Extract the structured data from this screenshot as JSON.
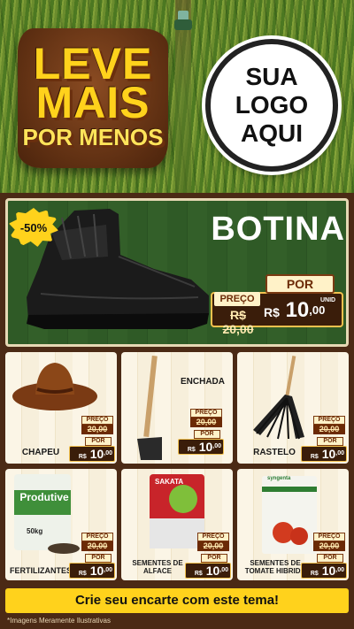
{
  "promo": {
    "line1": "LEVE",
    "line2": "MAIS",
    "line3": "POR MENOS"
  },
  "logo": {
    "text": "SUA LOGO AQUI"
  },
  "featured": {
    "discount": "-50%",
    "title": "BOTINA",
    "preco_label": "PREÇO",
    "por_label": "POR",
    "old_price": "R$ 20,00",
    "currency": "R$",
    "new_price_int": "10",
    "new_price_cents": ",00",
    "unit": "UNID"
  },
  "products": [
    {
      "name": "CHAPEU",
      "preco_label": "PREÇO",
      "old_price": "20,00",
      "por_label": "POR",
      "currency": "R$",
      "new_int": "10",
      "new_cents": ",00"
    },
    {
      "name": "ENCHADA",
      "preco_label": "PREÇO",
      "old_price": "20,00",
      "por_label": "POR",
      "currency": "R$",
      "new_int": "10",
      "new_cents": ",00"
    },
    {
      "name": "RASTELO",
      "preco_label": "PREÇO",
      "old_price": "20,00",
      "por_label": "POR",
      "currency": "R$",
      "new_int": "10",
      "new_cents": ",00"
    },
    {
      "name": "FERTILIZANTES",
      "preco_label": "PREÇO",
      "old_price": "20,00",
      "por_label": "POR",
      "currency": "R$",
      "new_int": "10",
      "new_cents": ",00",
      "package_brand": "Produtive",
      "package_weight": "50kg"
    },
    {
      "name": "SEMENTES DE ALFACE",
      "preco_label": "PREÇO",
      "old_price": "20,00",
      "por_label": "POR",
      "currency": "R$",
      "new_int": "10",
      "new_cents": ",00",
      "package_brand": "SAKATA"
    },
    {
      "name": "SEMENTES DE TOMATE HIBRIDA",
      "preco_label": "PREÇO",
      "old_price": "20,00",
      "por_label": "POR",
      "currency": "R$",
      "new_int": "10",
      "new_cents": ",00",
      "package_brand": "syngenta"
    }
  ],
  "footer": {
    "cta": "Crie seu encarte com este tema!",
    "disclaimer": "*Imagens Meramente Ilustrativas"
  },
  "colors": {
    "accent_yellow": "#ffd21c",
    "wood_dark": "#3a1d0a",
    "featured_green": "#2f5a26"
  }
}
